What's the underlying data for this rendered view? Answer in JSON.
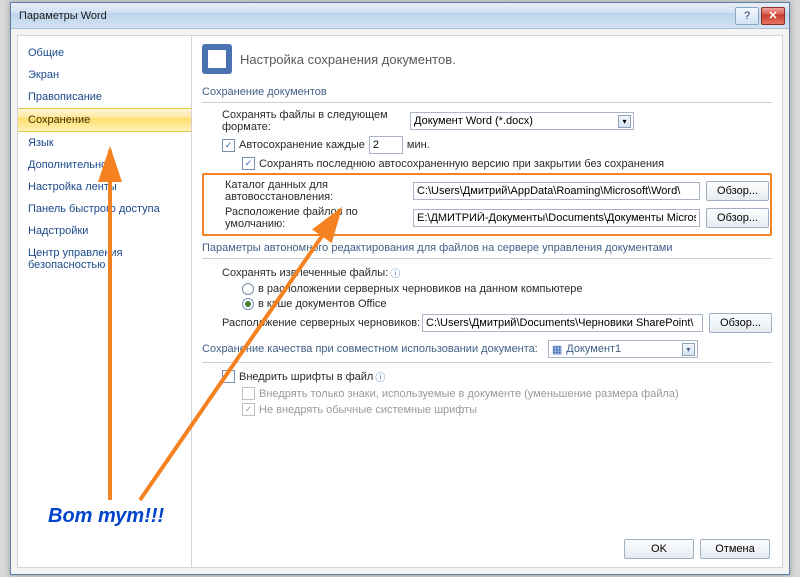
{
  "window": {
    "title": "Параметры Word"
  },
  "titlebar_icons": {
    "help": "?",
    "close": "✕"
  },
  "sidebar": {
    "items": [
      {
        "label": "Общие"
      },
      {
        "label": "Экран"
      },
      {
        "label": "Правописание"
      },
      {
        "label": "Сохранение",
        "active": true
      },
      {
        "label": "Язык"
      },
      {
        "label": "Дополнительно"
      },
      {
        "label": "Настройка ленты"
      },
      {
        "label": "Панель быстрого доступа"
      },
      {
        "label": "Надстройки"
      },
      {
        "label": "Центр управления безопасностью"
      }
    ]
  },
  "header": {
    "text": "Настройка сохранения документов."
  },
  "sec1": {
    "title": "Сохранение документов",
    "save_format_label": "Сохранять файлы в следующем формате:",
    "save_format_value": "Документ Word (*.docx)",
    "autosave_label": "Автосохранение каждые",
    "autosave_value": "2",
    "autosave_unit": "мин.",
    "keep_last_label": "Сохранять последнюю автосохраненную версию при закрытии без сохранения",
    "autorecover_label": "Каталог данных для автовосстановления:",
    "autorecover_path": "C:\\Users\\Дмитрий\\AppData\\Roaming\\Microsoft\\Word\\",
    "default_loc_label": "Расположение файлов по умолчанию:",
    "default_loc_path": "E:\\ДМИТРИЙ-Документы\\Documents\\Документы Microsoft Word",
    "browse": "Обзор..."
  },
  "sec2": {
    "title": "Параметры автономного редактирования для файлов на сервере управления документами",
    "save_checked_label": "Сохранять извлеченные файлы:",
    "opt1": "в расположении серверных черновиков на данном компьютере",
    "opt2": "в кэше документов Office",
    "drafts_label": "Расположение серверных черновиков:",
    "drafts_path": "C:\\Users\\Дмитрий\\Documents\\Черновики SharePoint\\",
    "browse": "Обзор..."
  },
  "sec3": {
    "title": "Сохранение качества при совместном использовании документа:",
    "doc_value": "Документ1",
    "embed_label": "Внедрить шрифты в файл",
    "embed_only": "Внедрять только знаки, используемые в документе (уменьшение размера файла)",
    "embed_skip": "Не внедрять обычные системные шрифты"
  },
  "buttons": {
    "ok": "OK",
    "cancel": "Отмена"
  },
  "annotation": {
    "text": "Вот тут!!!"
  }
}
